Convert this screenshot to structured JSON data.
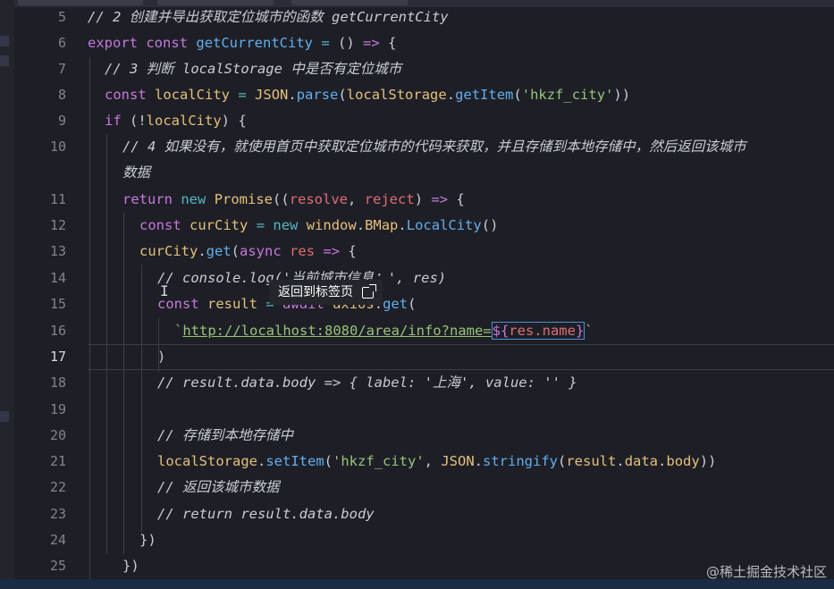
{
  "editor": {
    "active_line": 17,
    "lines": [
      {
        "num": "5",
        "code": "// 2 创建并导出获取定位城市的函数 getCurrentCity"
      },
      {
        "num": "6",
        "code": "export const getCurrentCity = () => {"
      },
      {
        "num": "7",
        "code": "// 3 判断 localStorage 中是否有定位城市"
      },
      {
        "num": "8",
        "code": "const localCity = JSON.parse(localStorage.getItem('hkzf_city'))"
      },
      {
        "num": "9",
        "code": "if (!localCity) {"
      },
      {
        "num": "10",
        "code": "// 4 如果没有，就使用首页中获取定位城市的代码来获取，并且存储到本地存储中，然后返回该城市"
      },
      {
        "num": "",
        "code": "数据"
      },
      {
        "num": "11",
        "code": "return new Promise((resolve, reject) => {"
      },
      {
        "num": "12",
        "code": "const curCity = new window.BMap.LocalCity()"
      },
      {
        "num": "13",
        "code": "curCity.get(async res => {"
      },
      {
        "num": "14",
        "code": "// console.log('当前城市信息：', res)"
      },
      {
        "num": "15",
        "code": "const result = await axios.get("
      },
      {
        "num": "16",
        "code": "`http://localhost:8080/area/info?name=${res.name}`"
      },
      {
        "num": "17",
        "code": ")"
      },
      {
        "num": "18",
        "code": "// result.data.body => { label: '上海', value: '' }"
      },
      {
        "num": "19",
        "code": ""
      },
      {
        "num": "20",
        "code": "// 存储到本地存储中"
      },
      {
        "num": "21",
        "code": "localStorage.setItem('hkzf_city', JSON.stringify(result.data.body))"
      },
      {
        "num": "22",
        "code": "// 返回该城市数据"
      },
      {
        "num": "23",
        "code": "// return result.data.body"
      },
      {
        "num": "24",
        "code": "})"
      },
      {
        "num": "25",
        "code": "})"
      }
    ]
  },
  "tooltip": {
    "label": "返回到标签页",
    "icon": "external-link-icon"
  },
  "watermark": {
    "text": "@稀土掘金技术社区"
  },
  "colors": {
    "background": "#1e1f26",
    "keyword": "#c678dd",
    "function": "#61afef",
    "string": "#98c379",
    "comment": "#7f848e"
  }
}
